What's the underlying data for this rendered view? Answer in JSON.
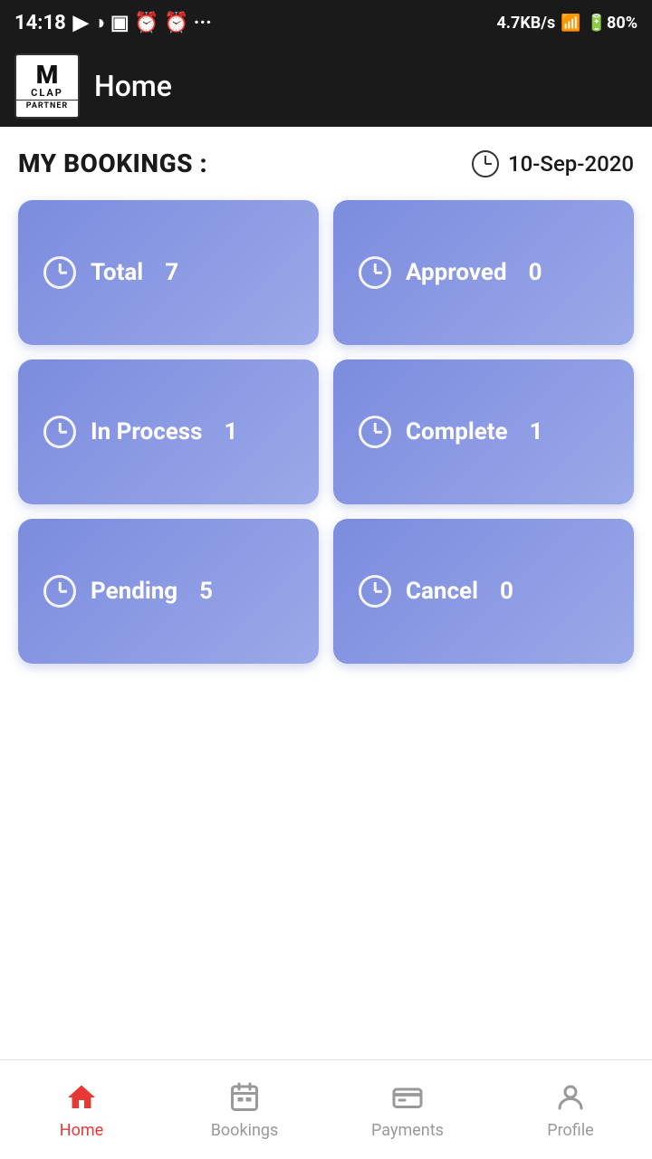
{
  "statusBar": {
    "time": "14:18",
    "battery": "80"
  },
  "header": {
    "logo": {
      "m": "M",
      "clap": "CLAP",
      "partner": "PARTNER"
    },
    "title": "Home"
  },
  "bookingsSection": {
    "title": "MY BOOKINGS :",
    "date": "10-Sep-2020",
    "cards": [
      {
        "id": "total",
        "label": "Total",
        "count": 7
      },
      {
        "id": "approved",
        "label": "Approved",
        "count": 0
      },
      {
        "id": "inprocess",
        "label": "In Process",
        "count": 1
      },
      {
        "id": "complete",
        "label": "Complete",
        "count": 1
      },
      {
        "id": "pending",
        "label": "Pending",
        "count": 5
      },
      {
        "id": "cancel",
        "label": "Cancel",
        "count": 0
      }
    ]
  },
  "bottomNav": {
    "items": [
      {
        "id": "home",
        "label": "Home",
        "active": true
      },
      {
        "id": "bookings",
        "label": "Bookings",
        "active": false
      },
      {
        "id": "payments",
        "label": "Payments",
        "active": false
      },
      {
        "id": "profile",
        "label": "Profile",
        "active": false
      }
    ]
  }
}
